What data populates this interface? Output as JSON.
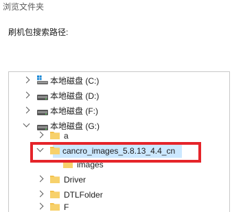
{
  "window": {
    "title": "浏览文件夹"
  },
  "prompt": "刷机包搜索路径:",
  "tree": {
    "items": [
      {
        "label": "本地磁盘 (C:)",
        "icon": "windows-drive-icon",
        "expanded": false
      },
      {
        "label": "本地磁盘 (D:)",
        "icon": "drive-icon",
        "expanded": false
      },
      {
        "label": "本地磁盘 (F:)",
        "icon": "drive-icon",
        "expanded": false
      },
      {
        "label": "本地磁盘 (G:)",
        "icon": "drive-icon",
        "expanded": true
      },
      {
        "label": "a",
        "icon": "folder-icon",
        "expanded": false
      },
      {
        "label": "cancro_images_5.8.13_4.4_cn",
        "icon": "folder-icon",
        "expanded": true,
        "selected": true
      },
      {
        "label": "images",
        "icon": "folder-icon",
        "expanded": false
      },
      {
        "label": "Driver",
        "icon": "folder-icon",
        "expanded": false
      },
      {
        "label": "DTLFolder",
        "icon": "folder-icon",
        "expanded": false
      },
      {
        "label": "F",
        "icon": "folder-icon",
        "expanded": false
      }
    ]
  },
  "colors": {
    "selection": "#cce8ff",
    "highlight_border": "#e5242a",
    "folder": "#f3c14b"
  }
}
